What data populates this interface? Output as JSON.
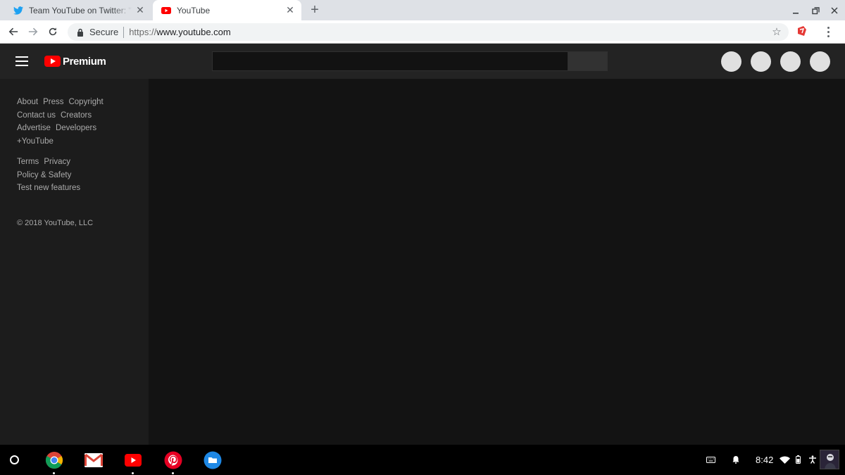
{
  "browser": {
    "tabs": [
      {
        "title": "Team YouTube on Twitter: \"Than",
        "favicon": "twitter-bird-icon",
        "active": false
      },
      {
        "title": "YouTube",
        "favicon": "youtube-icon",
        "active": true
      }
    ],
    "new_tab_icon": "plus-icon",
    "window_controls": [
      "minimize-icon",
      "restore-icon",
      "close-icon"
    ],
    "nav": [
      "back-arrow-icon",
      "forward-arrow-icon",
      "reload-icon"
    ],
    "omnibox": {
      "security_label": "Secure",
      "url_scheme": "https://",
      "url_host": "www.youtube.com"
    }
  },
  "youtube": {
    "brand_label": "Premium",
    "footer_links": {
      "row1": [
        "About",
        "Press",
        "Copyright"
      ],
      "row2": [
        "Contact us",
        "Creators"
      ],
      "row3": [
        "Advertise",
        "Developers"
      ],
      "row4": [
        "+YouTube"
      ],
      "row5": [
        "Terms",
        "Privacy"
      ],
      "row6": [
        "Policy & Safety"
      ],
      "row7": [
        "Test new features"
      ]
    },
    "copyright": "© 2018 YouTube, LLC"
  },
  "shelf": {
    "apps": [
      "chrome-icon",
      "gmail-icon",
      "youtube-icon",
      "pinterest-icon",
      "files-icon"
    ],
    "time": "8:42"
  },
  "colors": {
    "youtube_red": "#ff0000",
    "masthead_bg": "#232323",
    "guide_bg": "#1c1c1c",
    "content_bg": "#131313"
  }
}
